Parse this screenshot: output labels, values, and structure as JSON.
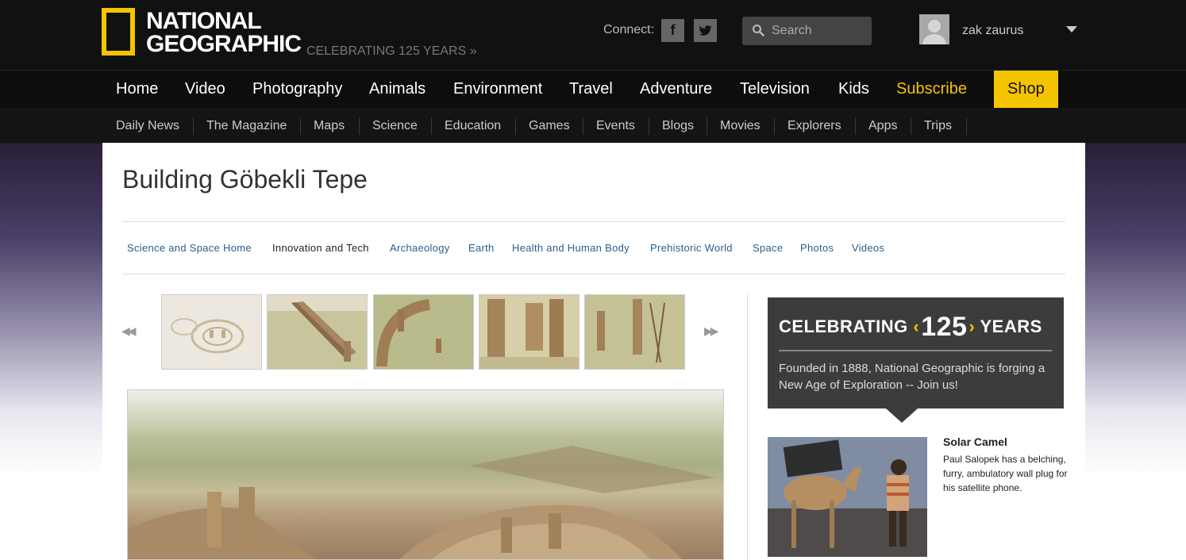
{
  "header": {
    "logo_line1": "NATIONAL",
    "logo_line2": "GEOGRAPHIC",
    "tagline": "CELEBRATING 125 YEARS »",
    "connect_label": "Connect:",
    "facebook_glyph": "f",
    "search_placeholder": "Search",
    "username": "zak zaurus"
  },
  "main_nav": [
    "Home",
    "Video",
    "Photography",
    "Animals",
    "Environment",
    "Travel",
    "Adventure",
    "Television",
    "Kids",
    "Subscribe",
    "Shop"
  ],
  "sub_nav": [
    "Daily News",
    "The Magazine",
    "Maps",
    "Science",
    "Education",
    "Games",
    "Events",
    "Blogs",
    "Movies",
    "Explorers",
    "Apps",
    "Trips"
  ],
  "page": {
    "title": "Building Göbekli Tepe"
  },
  "section_nav": [
    "Science and Space Home",
    "Innovation and Tech",
    "Archaeology",
    "Earth",
    "Health and Human Body",
    "Prehistoric World",
    "Space",
    "Photos",
    "Videos"
  ],
  "gallery": {
    "prev_glyph": "◀◀",
    "next_glyph": "▶▶"
  },
  "sidebar": {
    "promo_prefix": "CELEBRATING",
    "promo_number": "125",
    "promo_suffix": "YEARS",
    "promo_text": "Founded in 1888, National Geographic is forging a New Age of Exploration -- Join us!",
    "story_title": "Solar Camel",
    "story_text": "Paul Salopek has a belching, furry, ambulatory wall plug for his satellite phone."
  },
  "colors": {
    "brand_yellow": "#f5c400",
    "link_blue": "#2b5d8c"
  }
}
